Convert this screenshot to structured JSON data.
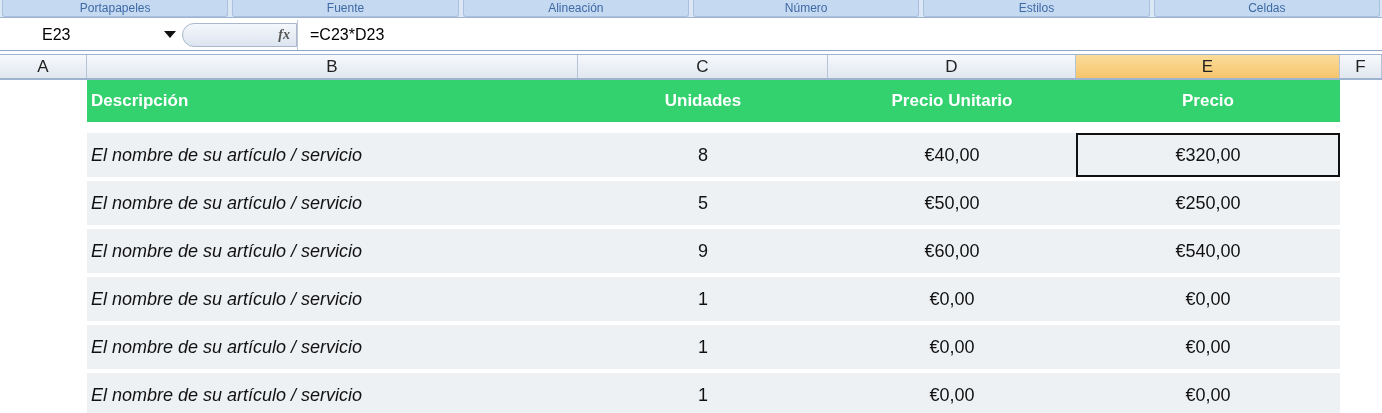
{
  "ribbon_groups": [
    "Portapapeles",
    "Fuente",
    "Alineación",
    "Número",
    "Estilos",
    "Celdas"
  ],
  "formula_bar": {
    "name_box": "E23",
    "function_symbol": "fx",
    "formula": "=C23*D23"
  },
  "column_headers": [
    {
      "label": "A",
      "selected": false
    },
    {
      "label": "B",
      "selected": false
    },
    {
      "label": "C",
      "selected": false
    },
    {
      "label": "D",
      "selected": false
    },
    {
      "label": "E",
      "selected": true
    },
    {
      "label": "F",
      "selected": false
    }
  ],
  "table": {
    "columns": [
      "Descripción",
      "Unidades",
      "Precio Unitario",
      "Precio"
    ],
    "rows": [
      {
        "cells": [
          {
            "text": "El nombre de su artículo / servicio",
            "selected": false
          },
          {
            "text": "8",
            "selected": false
          },
          {
            "text": "€40,00",
            "selected": false
          },
          {
            "text": "€320,00",
            "selected": true
          }
        ]
      },
      {
        "cells": [
          {
            "text": "El nombre de su artículo / servicio",
            "selected": false
          },
          {
            "text": "5",
            "selected": false
          },
          {
            "text": "€50,00",
            "selected": false
          },
          {
            "text": "€250,00",
            "selected": false
          }
        ]
      },
      {
        "cells": [
          {
            "text": "El nombre de su artículo / servicio",
            "selected": false
          },
          {
            "text": "9",
            "selected": false
          },
          {
            "text": "€60,00",
            "selected": false
          },
          {
            "text": "€540,00",
            "selected": false
          }
        ]
      },
      {
        "cells": [
          {
            "text": "El nombre de su artículo / servicio",
            "selected": false
          },
          {
            "text": "1",
            "selected": false
          },
          {
            "text": "€0,00",
            "selected": false
          },
          {
            "text": "€0,00",
            "selected": false
          }
        ]
      },
      {
        "cells": [
          {
            "text": "El nombre de su artículo / servicio",
            "selected": false
          },
          {
            "text": "1",
            "selected": false
          },
          {
            "text": "€0,00",
            "selected": false
          },
          {
            "text": "€0,00",
            "selected": false
          }
        ]
      },
      {
        "cells": [
          {
            "text": "El nombre de su artículo / servicio",
            "selected": false
          },
          {
            "text": "1",
            "selected": false
          },
          {
            "text": "€0,00",
            "selected": false
          },
          {
            "text": "€0,00",
            "selected": false
          }
        ]
      }
    ]
  }
}
